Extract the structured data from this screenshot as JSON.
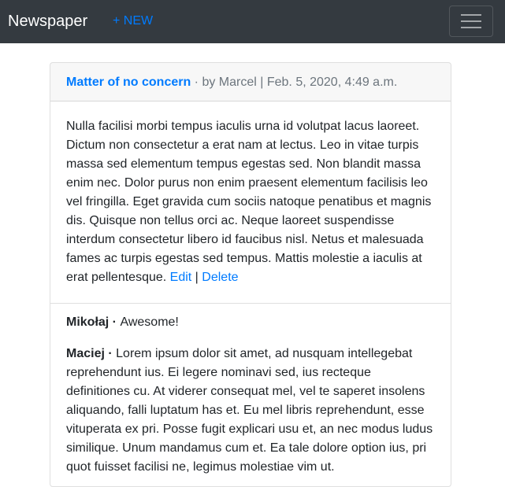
{
  "navbar": {
    "brand": "Newspaper",
    "new_link": "+ NEW",
    "toggler_icon": "hamburger-icon"
  },
  "article": {
    "title": "Matter of no concern",
    "meta_prefix": " · by ",
    "author": "Marcel",
    "separator": " | ",
    "date": "Feb. 5, 2020, 4:49 a.m.",
    "body": "Nulla facilisi morbi tempus iaculis urna id volutpat lacus laoreet. Dictum non consectetur a erat nam at lectus. Leo in vitae turpis massa sed elementum tempus egestas sed. Non blandit massa enim nec. Dolor purus non enim praesent elementum facilisis leo vel fringilla. Eget gravida cum sociis natoque penatibus et magnis dis. Quisque non tellus orci ac. Neque laoreet suspendisse interdum consectetur libero id faucibus nisl. Netus et malesuada fames ac turpis egestas sed tempus. Mattis molestie a iaculis at erat pellentesque.",
    "edit_label": "Edit",
    "action_separator": " | ",
    "delete_label": "Delete"
  },
  "comments": [
    {
      "author": "Mikołaj",
      "separator": " · ",
      "text": "Awesome!"
    },
    {
      "author": "Maciej",
      "separator": " · ",
      "text": "Lorem ipsum dolor sit amet, ad nusquam intellegebat reprehendunt ius. Ei legere nominavi sed, ius recteque definitiones cu. At viderer consequat mel, vel te saperet insolens aliquando, falli luptatum has et. Eu mel libris reprehendunt, esse vituperata ex pri. Posse fugit explicari usu et, an nec modus ludus similique. Unum mandamus cum et. Ea tale dolore option ius, pri quot fuisset facilisi ne, legimus molestiae vim ut."
    }
  ],
  "colors": {
    "navbar_bg": "#343a40",
    "link": "#007bff",
    "muted": "#6c757d"
  }
}
